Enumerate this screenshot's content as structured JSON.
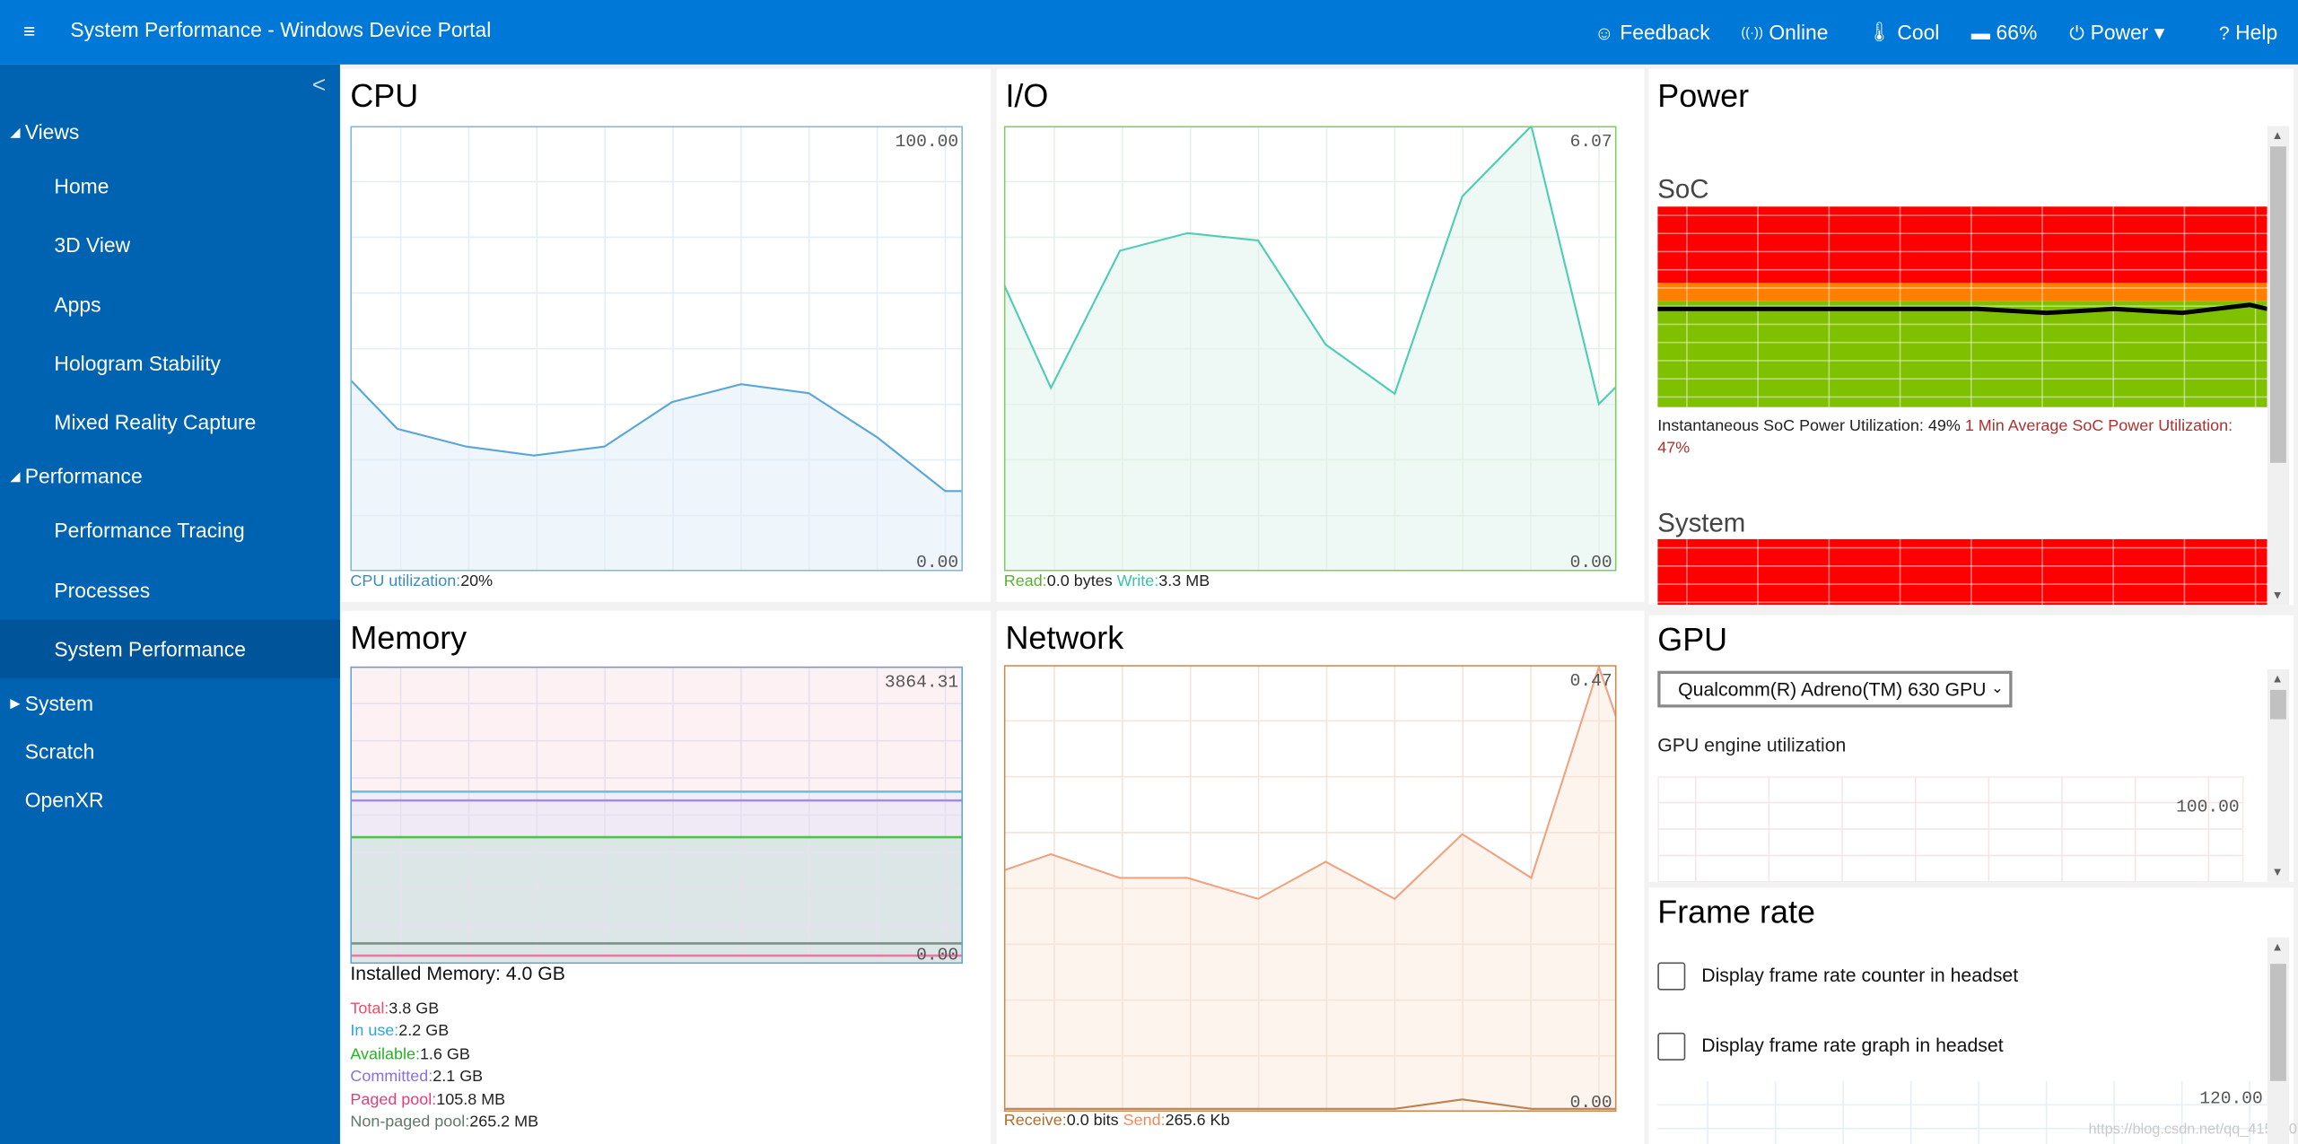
{
  "header": {
    "title": "System Performance - Windows Device Portal",
    "menu_icon": "hamburger-icon",
    "items": [
      {
        "icon": "smiley-icon",
        "glyph": "☺",
        "label": "Feedback"
      },
      {
        "icon": "wifi-icon",
        "glyph": "((·))",
        "label": "Online"
      },
      {
        "icon": "thermometer-icon",
        "glyph": "🌡",
        "label": "Cool"
      },
      {
        "icon": "battery-icon",
        "glyph": "▬",
        "label": "66%"
      },
      {
        "icon": "power-icon",
        "glyph": "⏻",
        "label": "Power ▾"
      },
      {
        "icon": "help-icon",
        "glyph": "?",
        "label": "Help"
      }
    ]
  },
  "sidebar": {
    "collapse_glyph": "<",
    "items": [
      {
        "label": "Views",
        "tri": "◢",
        "top": true
      },
      {
        "label": "Home"
      },
      {
        "label": "3D View"
      },
      {
        "label": "Apps"
      },
      {
        "label": "Hologram Stability"
      },
      {
        "label": "Mixed Reality Capture"
      },
      {
        "label": "Performance",
        "tri": "◢",
        "top": true
      },
      {
        "label": "Performance Tracing"
      },
      {
        "label": "Processes"
      },
      {
        "label": "System Performance",
        "selected": true
      },
      {
        "label": "System",
        "tri": "▶",
        "top": true
      },
      {
        "label": "Scratch",
        "top": true
      },
      {
        "label": "OpenXR",
        "top": true
      }
    ]
  },
  "cpu": {
    "title": "CPU",
    "util_label": "CPU utilization:",
    "util_value": "20%"
  },
  "io": {
    "title": "I/O",
    "read_label": "Read:",
    "read_value": "0.0 bytes",
    "write_label": "Write:",
    "write_value": "3.3 MB"
  },
  "memory": {
    "title": "Memory",
    "installed": "Installed Memory: 4.0 GB",
    "stats": [
      {
        "label": "Total:",
        "value": "3.8 GB",
        "color": "#e8506a"
      },
      {
        "label": "In use:",
        "value": "2.2 GB",
        "color": "#28a8e0"
      },
      {
        "label": "Available:",
        "value": "1.6 GB",
        "color": "#22b422"
      },
      {
        "label": "Committed:",
        "value": "2.1 GB",
        "color": "#8a6fe0"
      },
      {
        "label": "Paged pool:",
        "value": "105.8 MB",
        "color": "#e0407a"
      },
      {
        "label": "Non-paged pool:",
        "value": "265.2 MB",
        "color": "#607868"
      }
    ]
  },
  "network": {
    "title": "Network",
    "receive_label": "Receive:",
    "receive_value": "0.0 bits",
    "send_label": "Send:",
    "send_value": "265.6 Kb"
  },
  "power": {
    "title": "Power",
    "soc_title": "SoC",
    "inst_text": "Instantaneous SoC Power Utilization: 49%",
    "avg_text": "1 Min Average SoC Power Utilization: 47%",
    "system_title": "System"
  },
  "gpu": {
    "title": "GPU",
    "selected_gpu": "Qualcomm(R) Adreno(TM) 630 GPU",
    "engine_label": "GPU engine utilization"
  },
  "framerate": {
    "title": "Frame rate",
    "options": [
      {
        "label": "Display frame rate counter in headset",
        "checked": false
      },
      {
        "label": "Display frame rate graph in headset",
        "checked": false
      }
    ]
  },
  "watermark": "https://blog.csdn.net/qq_41598072",
  "chart_data": [
    {
      "id": "cpu",
      "type": "area",
      "ylim": [
        0,
        100
      ],
      "max_label": "100.00",
      "min_label": "0.00",
      "color": "#5aa6d6",
      "fill": "#eef5fb",
      "grid": "#e3eef7",
      "values": [
        43,
        32,
        28,
        26,
        28,
        38,
        42,
        40,
        30,
        18,
        18
      ]
    },
    {
      "id": "io",
      "type": "area",
      "ylim": [
        0,
        6.07
      ],
      "max_label": "6.07",
      "min_label": "0.00",
      "color": "#4ecdb4",
      "fill": "#eef8f5",
      "grid": "#e3f2e8",
      "border": "#7ccf5a",
      "values": [
        3.91,
        2.5,
        4.37,
        4.61,
        4.51,
        3.09,
        2.42,
        5.11,
        6.07,
        2.28,
        2.52
      ]
    },
    {
      "id": "memory",
      "type": "line",
      "ylim": [
        0,
        3864.31
      ],
      "max_label": "3864.31",
      "min_label": "0.00",
      "grid": "#e6e0ef",
      "border": "#5aa6d6",
      "series": [
        {
          "name": "Total",
          "value": 3864.31,
          "color": "#f4b8c4",
          "fill": "#fdf1f3"
        },
        {
          "name": "In use",
          "value": 2238,
          "color": "#6cc0e8",
          "fill": "#f2eef8"
        },
        {
          "name": "Committed",
          "value": 2123,
          "color": "#a58ae6",
          "fill": "#efeaf6"
        },
        {
          "name": "Available",
          "value": 1645,
          "color": "#4cc44c",
          "fill": "#dde6e6"
        },
        {
          "name": "Non-paged pool",
          "value": 265.2,
          "color": "#7a9484"
        },
        {
          "name": "Paged pool",
          "value": 105.8,
          "color": "#e67aa0"
        }
      ]
    },
    {
      "id": "network",
      "type": "area",
      "ylim": [
        0,
        0.47
      ],
      "max_label": "0.47",
      "min_label": "0.00",
      "color": "#eea383",
      "fill": "#fdf4ee",
      "grid": "#f5e4d8",
      "border": "#d08a50",
      "series": [
        {
          "name": "Send",
          "values": [
            0.254,
            0.271,
            0.246,
            0.246,
            0.224,
            0.263,
            0.224,
            0.292,
            0.246,
            0.468,
            0.414
          ]
        },
        {
          "name": "Receive",
          "values": [
            0,
            0,
            0,
            0,
            0,
            0,
            0,
            0.01,
            0,
            0,
            0
          ]
        }
      ]
    },
    {
      "id": "soc",
      "type": "line",
      "ylim": [
        0,
        100
      ],
      "values": [
        49,
        49,
        49,
        49,
        49,
        49,
        47,
        49,
        47,
        51,
        49
      ],
      "bands": [
        {
          "from": 0,
          "to": 53,
          "color": "#7fc000"
        },
        {
          "from": 53,
          "to": 62,
          "color": "#ff8000"
        },
        {
          "from": 62,
          "to": 100,
          "color": "#ff0000"
        }
      ]
    },
    {
      "id": "gpu",
      "type": "line",
      "ylim": [
        0,
        100
      ],
      "max_label": "100.00"
    },
    {
      "id": "framerate",
      "type": "line",
      "ylim": [
        0,
        120
      ],
      "max_label": "120.00"
    }
  ]
}
